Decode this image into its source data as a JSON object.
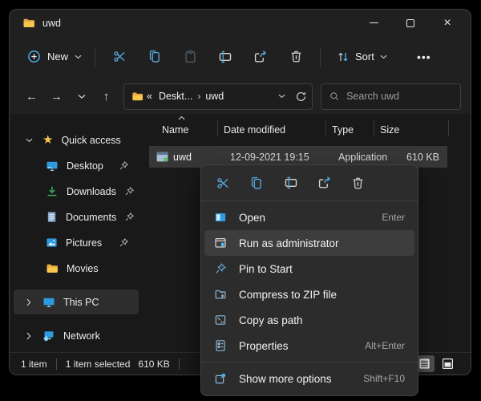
{
  "window": {
    "title": "uwd"
  },
  "toolbar": {
    "new_label": "New",
    "sort_label": "Sort",
    "more_label": "•••"
  },
  "navbar": {
    "breadcrumb": {
      "collapsed": "«",
      "parent": "Deskt...",
      "separator": "›",
      "current": "uwd"
    },
    "search_placeholder": "Search uwd"
  },
  "sidebar": {
    "quick_access_label": "Quick access",
    "items": [
      {
        "label": "Desktop",
        "icon": "desktop-icon",
        "pinned": true
      },
      {
        "label": "Downloads",
        "icon": "downloads-icon",
        "pinned": true
      },
      {
        "label": "Documents",
        "icon": "documents-icon",
        "pinned": true
      },
      {
        "label": "Pictures",
        "icon": "pictures-icon",
        "pinned": true
      },
      {
        "label": "Movies",
        "icon": "folder-icon",
        "pinned": false
      }
    ],
    "this_pc_label": "This PC",
    "network_label": "Network"
  },
  "filelist": {
    "columns": [
      "Name",
      "Date modified",
      "Type",
      "Size"
    ],
    "rows": [
      {
        "name": "uwd",
        "date_modified": "12-09-2021 19:15",
        "type": "Application",
        "size": "610 KB"
      }
    ]
  },
  "context_menu": {
    "items": [
      {
        "label": "Open",
        "shortcut": "Enter",
        "icon": "open-icon",
        "highlighted": false
      },
      {
        "label": "Run as administrator",
        "shortcut": "",
        "icon": "run-as-admin-icon",
        "highlighted": true
      },
      {
        "label": "Pin to Start",
        "shortcut": "",
        "icon": "pin-to-start-icon",
        "highlighted": false
      },
      {
        "label": "Compress to ZIP file",
        "shortcut": "",
        "icon": "zip-icon",
        "highlighted": false
      },
      {
        "label": "Copy as path",
        "shortcut": "",
        "icon": "copy-path-icon",
        "highlighted": false
      },
      {
        "label": "Properties",
        "shortcut": "Alt+Enter",
        "icon": "properties-icon",
        "highlighted": false
      },
      {
        "label": "Show more options",
        "shortcut": "Shift+F10",
        "icon": "show-more-icon",
        "highlighted": false
      }
    ]
  },
  "statusbar": {
    "count": "1 item",
    "selection": "1 item selected",
    "size": "610 KB"
  },
  "colors": {
    "accent": "#4cc2ff",
    "icon_blue": "#55a5d6",
    "folder_yellow": "#f7c64a",
    "folder_dark": "#e9a941",
    "download_green": "#38b764",
    "window_bg": "#202020",
    "content_bg": "#191919",
    "menu_bg": "#2c2c2c",
    "menu_highlight": "#3d3d3d",
    "selection_bg": "#373737"
  }
}
